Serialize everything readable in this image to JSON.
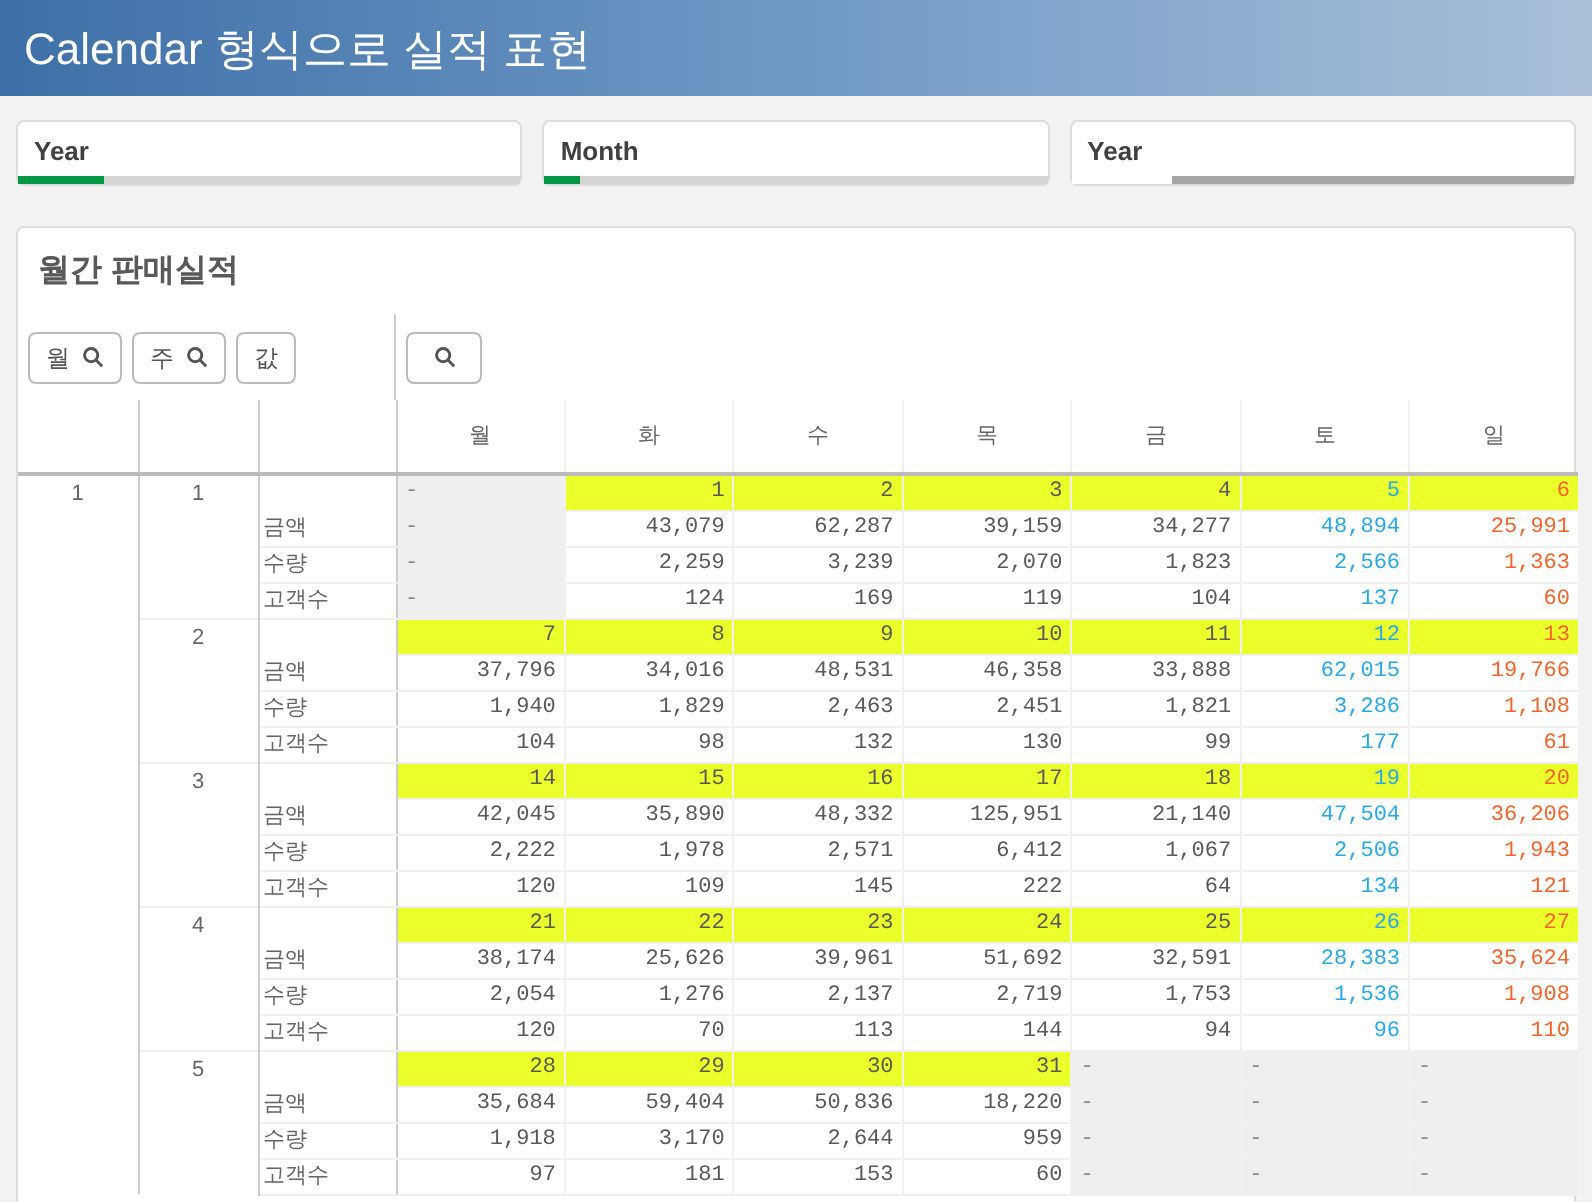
{
  "header": {
    "title": "Calendar 형식으로 실적 표현"
  },
  "filters": [
    {
      "label": "Year",
      "kind": "selected",
      "level": 0.17
    },
    {
      "label": "Month",
      "kind": "selected",
      "level": 0.07
    },
    {
      "label": "Year",
      "kind": "alternative",
      "level": 0.2
    }
  ],
  "panel": {
    "title": "월간 판매실적",
    "dimension_buttons": [
      {
        "label": "월",
        "searchable": true
      },
      {
        "label": "주",
        "searchable": true
      },
      {
        "label": "값",
        "searchable": false
      }
    ],
    "columns": [
      {
        "label": "월",
        "color": "#595959"
      },
      {
        "label": "화",
        "color": "#595959"
      },
      {
        "label": "수",
        "color": "#595959"
      },
      {
        "label": "목",
        "color": "#595959"
      },
      {
        "label": "금",
        "color": "#595959"
      },
      {
        "label": "토",
        "color": "#29a8ec"
      },
      {
        "label": "일",
        "color": "#f4642c"
      }
    ],
    "month": "1",
    "weeks": [
      {
        "week": "1",
        "days": [
          {
            "day": "-",
            "in_month": false
          },
          {
            "day": "1",
            "in_month": true
          },
          {
            "day": "2",
            "in_month": true
          },
          {
            "day": "3",
            "in_month": true
          },
          {
            "day": "4",
            "in_month": true
          },
          {
            "day": "5",
            "in_month": true
          },
          {
            "day": "6",
            "in_month": true
          }
        ],
        "rows": [
          {
            "label": "금액",
            "values": [
              "-",
              "43,079",
              "62,287",
              "39,159",
              "34,277",
              "48,894",
              "25,991"
            ]
          },
          {
            "label": "수량",
            "values": [
              "-",
              "2,259",
              "3,239",
              "2,070",
              "1,823",
              "2,566",
              "1,363"
            ]
          },
          {
            "label": "고객수",
            "values": [
              "-",
              "124",
              "169",
              "119",
              "104",
              "137",
              "60"
            ]
          }
        ]
      },
      {
        "week": "2",
        "days": [
          {
            "day": "7",
            "in_month": true
          },
          {
            "day": "8",
            "in_month": true
          },
          {
            "day": "9",
            "in_month": true
          },
          {
            "day": "10",
            "in_month": true
          },
          {
            "day": "11",
            "in_month": true
          },
          {
            "day": "12",
            "in_month": true
          },
          {
            "day": "13",
            "in_month": true
          }
        ],
        "rows": [
          {
            "label": "금액",
            "values": [
              "37,796",
              "34,016",
              "48,531",
              "46,358",
              "33,888",
              "62,015",
              "19,766"
            ]
          },
          {
            "label": "수량",
            "values": [
              "1,940",
              "1,829",
              "2,463",
              "2,451",
              "1,821",
              "3,286",
              "1,108"
            ]
          },
          {
            "label": "고객수",
            "values": [
              "104",
              "98",
              "132",
              "130",
              "99",
              "177",
              "61"
            ]
          }
        ]
      },
      {
        "week": "3",
        "days": [
          {
            "day": "14",
            "in_month": true
          },
          {
            "day": "15",
            "in_month": true
          },
          {
            "day": "16",
            "in_month": true
          },
          {
            "day": "17",
            "in_month": true
          },
          {
            "day": "18",
            "in_month": true
          },
          {
            "day": "19",
            "in_month": true
          },
          {
            "day": "20",
            "in_month": true
          }
        ],
        "rows": [
          {
            "label": "금액",
            "values": [
              "42,045",
              "35,890",
              "48,332",
              "125,951",
              "21,140",
              "47,504",
              "36,206"
            ]
          },
          {
            "label": "수량",
            "values": [
              "2,222",
              "1,978",
              "2,571",
              "6,412",
              "1,067",
              "2,506",
              "1,943"
            ]
          },
          {
            "label": "고객수",
            "values": [
              "120",
              "109",
              "145",
              "222",
              "64",
              "134",
              "121"
            ]
          }
        ]
      },
      {
        "week": "4",
        "days": [
          {
            "day": "21",
            "in_month": true
          },
          {
            "day": "22",
            "in_month": true
          },
          {
            "day": "23",
            "in_month": true
          },
          {
            "day": "24",
            "in_month": true
          },
          {
            "day": "25",
            "in_month": true
          },
          {
            "day": "26",
            "in_month": true
          },
          {
            "day": "27",
            "in_month": true
          }
        ],
        "rows": [
          {
            "label": "금액",
            "values": [
              "38,174",
              "25,626",
              "39,961",
              "51,692",
              "32,591",
              "28,383",
              "35,624"
            ]
          },
          {
            "label": "수량",
            "values": [
              "2,054",
              "1,276",
              "2,137",
              "2,719",
              "1,753",
              "1,536",
              "1,908"
            ]
          },
          {
            "label": "고객수",
            "values": [
              "120",
              "70",
              "113",
              "144",
              "94",
              "96",
              "110"
            ]
          }
        ]
      },
      {
        "week": "5",
        "days": [
          {
            "day": "28",
            "in_month": true
          },
          {
            "day": "29",
            "in_month": true
          },
          {
            "day": "30",
            "in_month": true
          },
          {
            "day": "31",
            "in_month": true
          },
          {
            "day": "-",
            "in_month": false
          },
          {
            "day": "-",
            "in_month": false
          },
          {
            "day": "-",
            "in_month": false
          }
        ],
        "rows": [
          {
            "label": "금액",
            "values": [
              "35,684",
              "59,404",
              "50,836",
              "18,220",
              "-",
              "-",
              "-"
            ]
          },
          {
            "label": "수량",
            "values": [
              "1,918",
              "3,170",
              "2,644",
              "959",
              "-",
              "-",
              "-"
            ]
          },
          {
            "label": "고객수",
            "values": [
              "97",
              "181",
              "153",
              "60",
              "-",
              "-",
              "-"
            ]
          }
        ]
      }
    ]
  }
}
